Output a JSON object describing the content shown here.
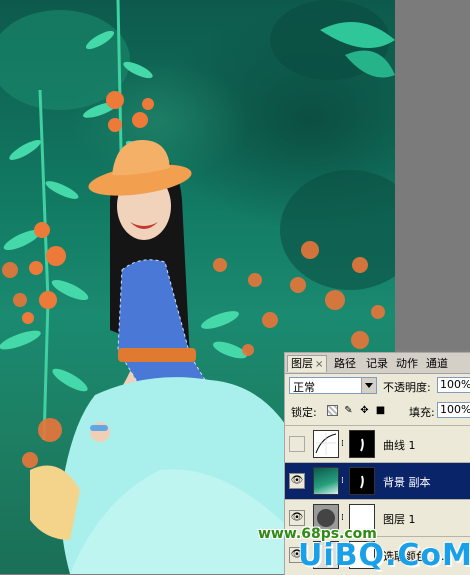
{
  "tabs": [
    {
      "label": "图层",
      "close": "×"
    },
    {
      "label": "路径"
    },
    {
      "label": "记录"
    },
    {
      "label": "动作"
    },
    {
      "label": "通道"
    }
  ],
  "blend_mode": "正常",
  "opacity_label": "不透明度:",
  "opacity_value": "100%",
  "lock_label": "锁定:",
  "fill_label": "填充:",
  "fill_value": "100%",
  "layers": [
    {
      "name": "曲线 1",
      "visible": false,
      "type": "adjustment-curves",
      "selected": false
    },
    {
      "name": "背景 副本",
      "visible": true,
      "type": "photo",
      "selected": true
    },
    {
      "name": "图层 1",
      "visible": true,
      "type": "fill-circle",
      "selected": false
    },
    {
      "name": "选取颜色 1 ...",
      "visible": true,
      "type": "adjustment",
      "selected": false
    }
  ],
  "watermark_small": "www.68ps.com",
  "watermark_large": "UiBQ.CoM",
  "colors": {
    "photo_bg": "#127a63",
    "flower": "#ee7a3a",
    "hat": "#f2a050",
    "dress": "#a9f0ec",
    "selected_row": "#0a246a",
    "panel_bg": "#ece9d8"
  }
}
